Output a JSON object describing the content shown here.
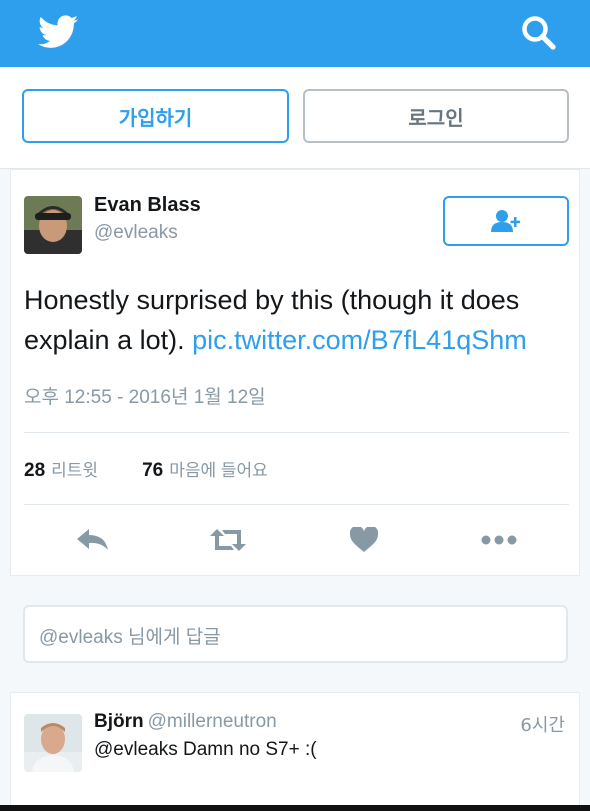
{
  "header": {
    "logo_icon": "twitter-bird-icon",
    "search_icon": "search-icon",
    "brand_color": "#2d9fec"
  },
  "auth": {
    "signup_label": "가입하기",
    "login_label": "로그인"
  },
  "tweet": {
    "author_name": "Evan Blass",
    "author_handle": "@evleaks",
    "follow_icon": "add-user-icon",
    "text": "Honestly surprised by this (though it does explain a lot). ",
    "link": "pic.twitter.com/B7fL41qShm",
    "timestamp": "오후 12:55 - 2016년 1월 12일",
    "retweet_count": "28",
    "retweet_label": "리트윗",
    "like_count": "76",
    "like_label": "마음에 들어요",
    "actions": [
      "reply-icon",
      "retweet-icon",
      "heart-icon",
      "more-icon"
    ]
  },
  "reply_box": {
    "placeholder": "@evleaks 님에게 답글"
  },
  "reply": {
    "name": "Björn",
    "handle": "@millerneutron",
    "time": "6시간",
    "text": "@evleaks Damn no S7+ :("
  }
}
